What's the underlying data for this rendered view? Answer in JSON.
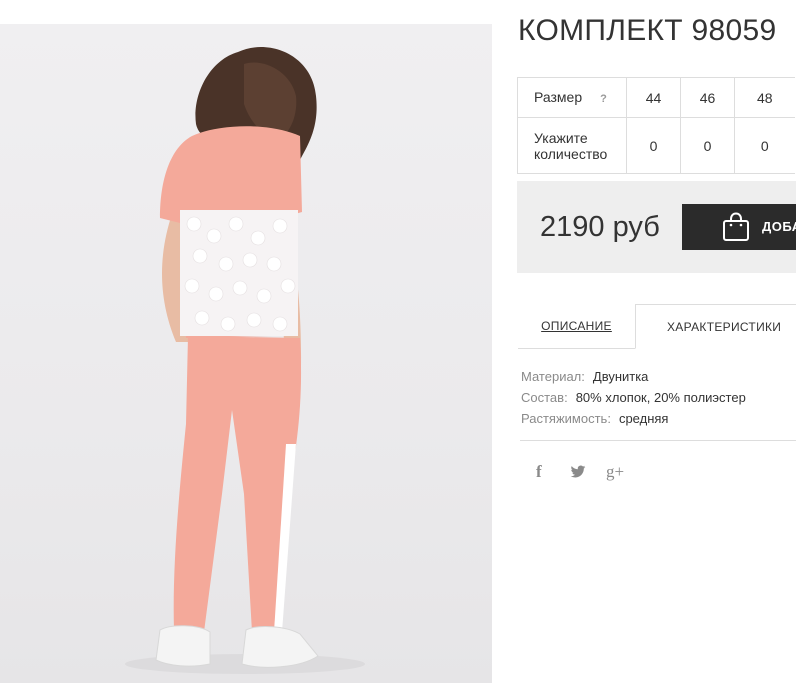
{
  "product": {
    "title": "КОМПЛЕКТ 98059"
  },
  "sizes": {
    "size_label": "Размер",
    "help_label": "?",
    "qty_label_line1": "Укажите",
    "qty_label_line2": "количество",
    "options": [
      {
        "size": "44",
        "qty": "0"
      },
      {
        "size": "46",
        "qty": "0"
      },
      {
        "size": "48",
        "qty": "0"
      }
    ]
  },
  "price": {
    "text": "2190 руб",
    "cart_label": "ДОБА"
  },
  "tabs": {
    "description": "ОПИСАНИЕ",
    "characteristics": "ХАРАКТЕРИСТИКИ"
  },
  "specs": [
    {
      "key": "Материал:",
      "value": "Двунитка"
    },
    {
      "key": "Состав:",
      "value": "80% хлопок, 20% полиэстер"
    },
    {
      "key": "Растяжимость:",
      "value": "средняя"
    }
  ],
  "social": {
    "facebook": "f",
    "twitter": "twitter-icon",
    "googleplus": "g+"
  },
  "colors": {
    "accent_dark": "#2b2b2b",
    "price_bg": "#eeeeee",
    "garment": "#f4a99a"
  }
}
